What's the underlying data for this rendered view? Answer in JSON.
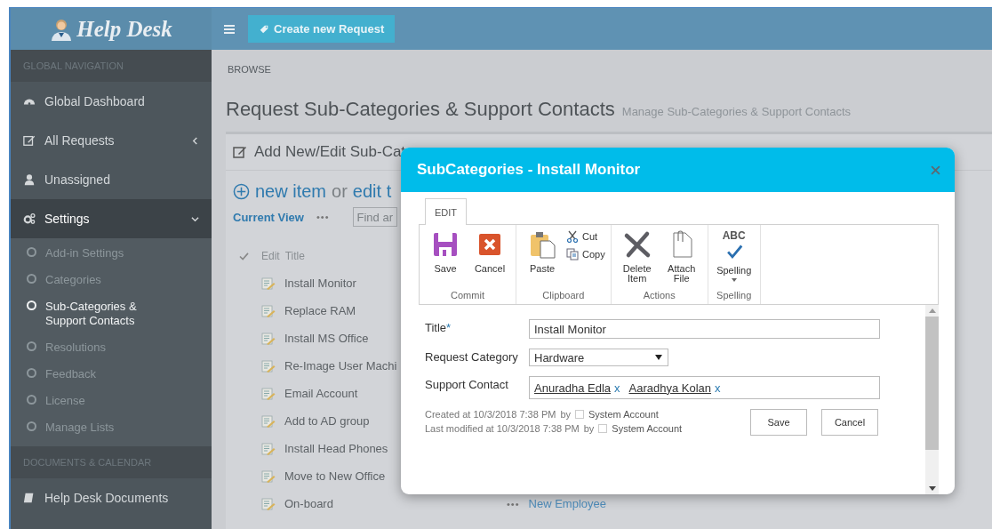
{
  "app": {
    "title": "Help Desk"
  },
  "toolbar": {
    "create_button": "Create new Request"
  },
  "sidebar": {
    "sections": [
      {
        "heading": "GLOBAL NAVIGATION",
        "items": [
          {
            "label": "Global Dashboard",
            "selected": false
          },
          {
            "label": "All Requests",
            "selected": false,
            "expanded": false
          },
          {
            "label": "Unassigned",
            "selected": false
          },
          {
            "label": "Settings",
            "selected": true,
            "expanded": true,
            "children": [
              {
                "label": "Add-in Settings",
                "selected": false
              },
              {
                "label": "Categories",
                "selected": false
              },
              {
                "label": "Sub-Categories & Support Contacts",
                "selected": true
              },
              {
                "label": "Resolutions",
                "selected": false
              },
              {
                "label": "Feedback",
                "selected": false
              },
              {
                "label": "License",
                "selected": false
              },
              {
                "label": "Manage Lists",
                "selected": false
              }
            ]
          }
        ]
      },
      {
        "heading": "DOCUMENTS & CALENDAR",
        "items": [
          {
            "label": "Help Desk Documents",
            "selected": false
          }
        ]
      }
    ]
  },
  "main": {
    "breadcrumb": "BROWSE",
    "title": "Request Sub-Categories & Support Contacts",
    "subtitle": "Manage Sub-Categories & Support Contacts",
    "panel": {
      "title": "Add New/Edit Sub-Cat",
      "new_item": "new item",
      "or": "or",
      "edit": "edit t",
      "current_view": "Current View",
      "more": "•••",
      "search": {
        "placeholder": "Find ar"
      },
      "columns": [
        "Edit",
        "Title"
      ],
      "rows": [
        {
          "title": "Install Monitor"
        },
        {
          "title": "Replace RAM"
        },
        {
          "title": "Install MS Office"
        },
        {
          "title": "Re-Image User Machi"
        },
        {
          "title": "Email Account"
        },
        {
          "title": "Add to AD group"
        },
        {
          "title": "Install Head Phones"
        },
        {
          "title": "Move to New Office"
        },
        {
          "title": "On-board",
          "more": "•••",
          "column_3": "New Employee"
        }
      ]
    }
  },
  "dialog": {
    "title": "SubCategories - Install Monitor",
    "tabs": [
      {
        "label": "EDIT",
        "selected": true
      }
    ],
    "ribbon": [
      {
        "label": "Commit",
        "buttons": [
          {
            "label": "Save",
            "kind": "save"
          },
          {
            "label": "Cancel",
            "kind": "cancel"
          }
        ]
      },
      {
        "label": "Clipboard",
        "buttons": [
          {
            "label": "Paste",
            "kind": "paste"
          },
          {
            "label": "Cut",
            "kind": "cut"
          },
          {
            "label": "Copy",
            "kind": "copy"
          }
        ]
      },
      {
        "label": "Actions",
        "buttons": [
          {
            "label": "Delete Item",
            "kind": "delete"
          },
          {
            "label": "Attach File",
            "kind": "attach"
          }
        ]
      },
      {
        "label": "Spelling",
        "buttons": [
          {
            "label": "Spelling",
            "kind": "spelling",
            "icon_text": "ABC"
          }
        ]
      }
    ],
    "fields": [
      {
        "label": "Title",
        "required_mark": "*",
        "kind": "text",
        "value": "Install Monitor"
      },
      {
        "label": "Request Category",
        "kind": "select",
        "value": "Hardware"
      },
      {
        "label": "Support Contact",
        "kind": "people",
        "people": [
          {
            "name": "Anuradha Edla",
            "remove": "x"
          },
          {
            "name": "Aaradhya Kolan",
            "remove": "x"
          }
        ]
      }
    ],
    "meta": [
      {
        "text": "Created at 10/3/2018 7:38 PM",
        "by": "by",
        "user": "System Account"
      },
      {
        "text": "Last modified at 10/3/2018 7:38 PM",
        "by": "by",
        "user": "System Account"
      }
    ],
    "buttons": [
      "Save",
      "Cancel"
    ]
  }
}
